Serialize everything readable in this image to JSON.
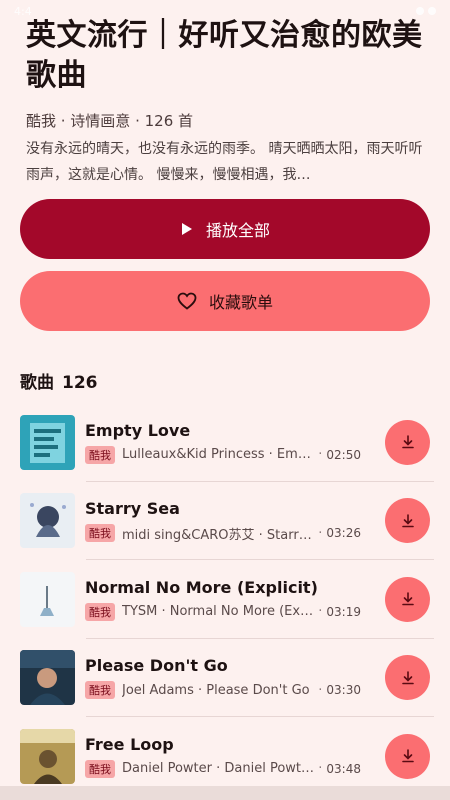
{
  "status": {
    "time": "4:4"
  },
  "header": {
    "title": "英文流行｜好听又治愈的欧美歌曲",
    "subtitle": "酷我 · 诗情画意 · 126 首",
    "description": "没有永远的晴天，也没有永远的雨季。 晴天晒晒太阳，雨天听听雨声，这就是心情。 慢慢来，慢慢相遇，我…"
  },
  "actions": {
    "play_all": "播放全部",
    "favorite": "收藏歌单",
    "play_icon": "play-icon",
    "heart_icon": "heart-icon"
  },
  "songs_section": {
    "label": "歌曲",
    "count": "126"
  },
  "songs": [
    {
      "title": "Empty Love",
      "tag": "酷我",
      "artist": "Lulleaux&Kid Princess · Empty Love",
      "duration": "02:50"
    },
    {
      "title": "Starry Sea",
      "tag": "酷我",
      "artist": "midi sing&CARO苏艾 · Starry Sea",
      "duration": "03:26"
    },
    {
      "title": "Normal No More (Explicit)",
      "tag": "酷我",
      "artist": "TYSM · Normal No More (Explicit)",
      "duration": "03:19"
    },
    {
      "title": "Please Don't Go",
      "tag": "酷我",
      "artist": "Joel Adams · Please Don't Go",
      "duration": "03:30"
    },
    {
      "title": "Free Loop",
      "tag": "酷我",
      "artist": "Daniel Powter · Daniel Powter",
      "duration": "03:48"
    }
  ],
  "colors": {
    "primary": "#a3082a",
    "accent": "#fb6e71",
    "background": "#fdf1ef"
  },
  "icons": {
    "download": "download-icon"
  }
}
